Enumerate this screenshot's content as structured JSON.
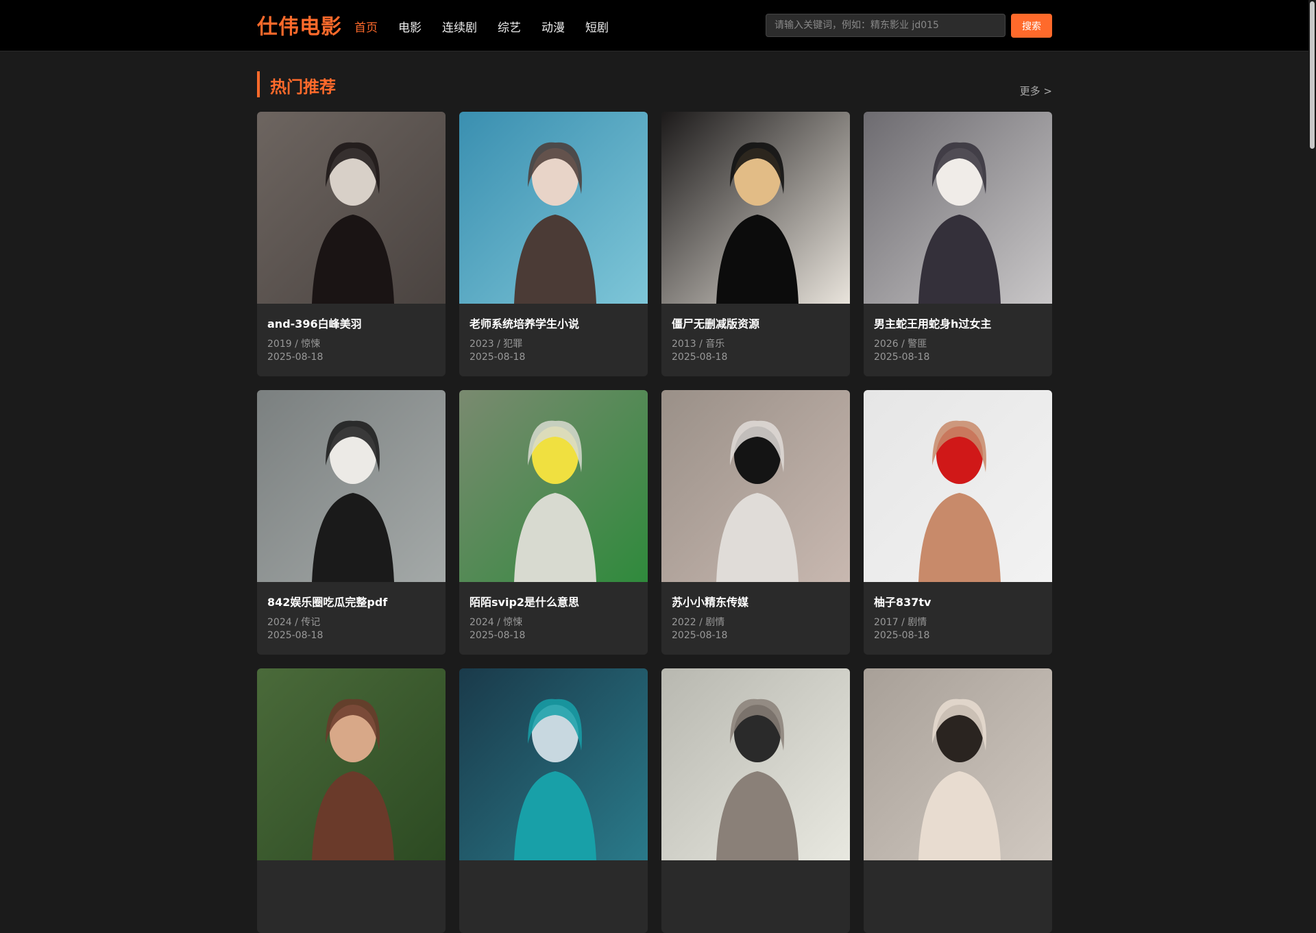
{
  "header": {
    "logo": "仕伟电影",
    "nav": [
      {
        "label": "首页",
        "active": true
      },
      {
        "label": "电影",
        "active": false
      },
      {
        "label": "连续剧",
        "active": false
      },
      {
        "label": "综艺",
        "active": false
      },
      {
        "label": "动漫",
        "active": false
      },
      {
        "label": "短剧",
        "active": false
      }
    ],
    "search_placeholder": "请输入关键词，例如：精东影业 jd015",
    "search_button": "搜索"
  },
  "section": {
    "title": "热门推荐",
    "more": "更多 >"
  },
  "cards": [
    {
      "title": "and-396白峰美羽",
      "meta": "2019 / 惊悚",
      "date": "2025-08-18",
      "palette": [
        "#6d6560",
        "#4a4340",
        "#d8d0c8",
        "#1a1414"
      ]
    },
    {
      "title": "老师系统培养学生小说",
      "meta": "2023 / 犯罪",
      "date": "2025-08-18",
      "palette": [
        "#3a8fb0",
        "#7ec6d8",
        "#e8d4c8",
        "#4b3b36"
      ]
    },
    {
      "title": "僵尸无删减版资源",
      "meta": "2013 / 音乐",
      "date": "2025-08-18",
      "palette": [
        "#1c1a1a",
        "#e9e4dc",
        "#e2bc86",
        "#0c0c0c"
      ]
    },
    {
      "title": "男主蛇王用蛇身h过女主",
      "meta": "2026 / 警匪",
      "date": "2025-08-18",
      "palette": [
        "#6d6b70",
        "#c9c7c8",
        "#f0ece8",
        "#34303a"
      ]
    },
    {
      "title": "842娱乐圈吃瓜完整pdf",
      "meta": "2024 / 传记",
      "date": "2025-08-18",
      "palette": [
        "#7b8080",
        "#a4a9a8",
        "#eceae6",
        "#1a1a1a"
      ]
    },
    {
      "title": "陌陌svip2是什么意思",
      "meta": "2024 / 惊悚",
      "date": "2025-08-18",
      "palette": [
        "#7a8a70",
        "#2f8a3c",
        "#f0e040",
        "#d8dad0"
      ]
    },
    {
      "title": "苏小小精东传媒",
      "meta": "2022 / 剧情",
      "date": "2025-08-18",
      "palette": [
        "#9a9088",
        "#c8b8b0",
        "#141414",
        "#e0dcd8"
      ]
    },
    {
      "title": "柚子837tv",
      "meta": "2017 / 剧情",
      "date": "2025-08-18",
      "palette": [
        "#e6e6e6",
        "#f2f2f2",
        "#d01818",
        "#c88a6a"
      ]
    },
    {
      "title": "",
      "meta": "",
      "date": "",
      "palette": [
        "#4a6a3a",
        "#2c4a22",
        "#d8a888",
        "#6a3a2a"
      ]
    },
    {
      "title": "",
      "meta": "",
      "date": "",
      "palette": [
        "#1a3a4a",
        "#2a7a8a",
        "#c8d8e0",
        "#18a0a8"
      ]
    },
    {
      "title": "",
      "meta": "",
      "date": "",
      "palette": [
        "#b8b8b0",
        "#e8e8e0",
        "#2a2a2a",
        "#8a8078"
      ]
    },
    {
      "title": "",
      "meta": "",
      "date": "",
      "palette": [
        "#a8a098",
        "#d0c8c0",
        "#2a2420",
        "#e8dcd0"
      ]
    }
  ],
  "colors": {
    "accent": "#ff6a2b",
    "background": "#1b1b1b",
    "card": "#2a2a2a"
  }
}
